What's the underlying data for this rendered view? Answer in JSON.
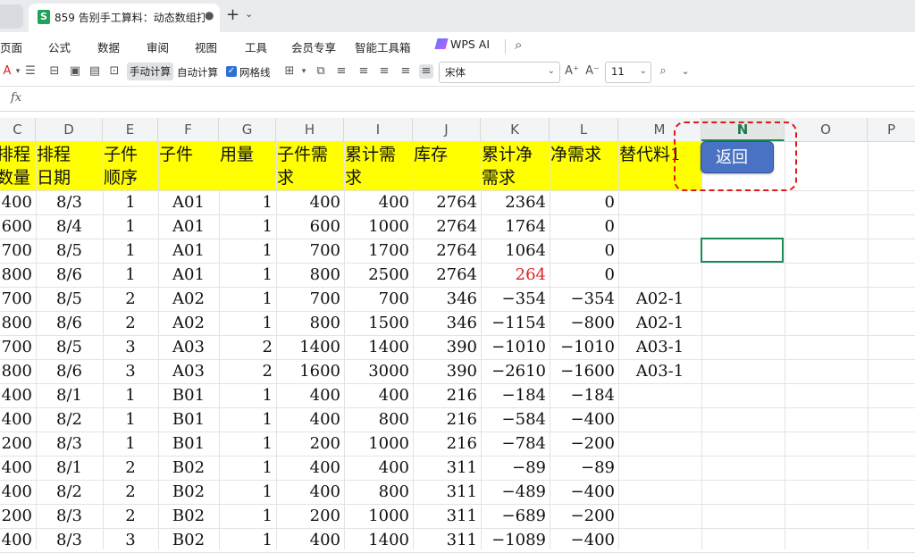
{
  "tab": {
    "icon": "S",
    "title": "859 告别手工算料：动态数组打造",
    "modified_dot": "●",
    "new_tab": "+",
    "dropdown": "⌄"
  },
  "menu": [
    "页面",
    "公式",
    "数据",
    "审阅",
    "视图",
    "工具",
    "会员专享",
    "智能工具箱"
  ],
  "wps_ai": "WPS AI",
  "toolbar": {
    "manual_calc": "手动计算",
    "auto_calc": "自动计算",
    "gridlines": "网格线",
    "font": "宋体",
    "font_size": "11"
  },
  "formula_bar": {
    "fx": "fx"
  },
  "columns": [
    "C",
    "D",
    "E",
    "F",
    "G",
    "H",
    "I",
    "J",
    "K",
    "L",
    "M",
    "N",
    "O",
    "P"
  ],
  "selected_column": "N",
  "headers": [
    {
      "l1": "排程",
      "l2": "数量"
    },
    {
      "l1": "排程",
      "l2": "日期"
    },
    {
      "l1": "子件",
      "l2": "顺序"
    },
    {
      "l1": "子件",
      "l2": ""
    },
    {
      "l1": "用量",
      "l2": ""
    },
    {
      "l1": "子件需",
      "l2": "求"
    },
    {
      "l1": "累计需",
      "l2": "求"
    },
    {
      "l1": "库存",
      "l2": ""
    },
    {
      "l1": "累计净",
      "l2": "需求"
    },
    {
      "l1": "净需求",
      "l2": ""
    },
    {
      "l1": "替代料1",
      "l2": ""
    }
  ],
  "rows": [
    [
      "400",
      "8/3",
      "1",
      "A01",
      "1",
      "400",
      "400",
      "2764",
      "2364",
      "0",
      ""
    ],
    [
      "600",
      "8/4",
      "1",
      "A01",
      "1",
      "600",
      "1000",
      "2764",
      "1764",
      "0",
      ""
    ],
    [
      "700",
      "8/5",
      "1",
      "A01",
      "1",
      "700",
      "1700",
      "2764",
      "1064",
      "0",
      ""
    ],
    [
      "800",
      "8/6",
      "1",
      "A01",
      "1",
      "800",
      "2500",
      "2764",
      "264",
      "0",
      ""
    ],
    [
      "700",
      "8/5",
      "2",
      "A02",
      "1",
      "700",
      "700",
      "346",
      "-354",
      "-354",
      "A02-1"
    ],
    [
      "800",
      "8/6",
      "2",
      "A02",
      "1",
      "800",
      "1500",
      "346",
      "-1154",
      "-800",
      "A02-1"
    ],
    [
      "700",
      "8/5",
      "3",
      "A03",
      "2",
      "1400",
      "1400",
      "390",
      "-1010",
      "-1010",
      "A03-1"
    ],
    [
      "800",
      "8/6",
      "3",
      "A03",
      "2",
      "1600",
      "3000",
      "390",
      "-2610",
      "-1600",
      "A03-1"
    ],
    [
      "400",
      "8/1",
      "1",
      "B01",
      "1",
      "400",
      "400",
      "216",
      "-184",
      "-184",
      ""
    ],
    [
      "400",
      "8/2",
      "1",
      "B01",
      "1",
      "400",
      "800",
      "216",
      "-584",
      "-400",
      ""
    ],
    [
      "200",
      "8/3",
      "1",
      "B01",
      "1",
      "200",
      "1000",
      "216",
      "-784",
      "-200",
      ""
    ],
    [
      "400",
      "8/1",
      "2",
      "B02",
      "1",
      "400",
      "400",
      "311",
      "-89",
      "-89",
      ""
    ],
    [
      "400",
      "8/2",
      "2",
      "B02",
      "1",
      "400",
      "800",
      "311",
      "-489",
      "-400",
      ""
    ],
    [
      "200",
      "8/3",
      "2",
      "B02",
      "1",
      "200",
      "1000",
      "311",
      "-689",
      "-200",
      ""
    ],
    [
      "400",
      "8/3",
      "3",
      "B02",
      "1",
      "400",
      "1400",
      "311",
      "-1089",
      "-400",
      ""
    ]
  ],
  "highlight": {
    "row": 3,
    "col": 8,
    "color": "#e02020"
  },
  "return_button": "返回"
}
